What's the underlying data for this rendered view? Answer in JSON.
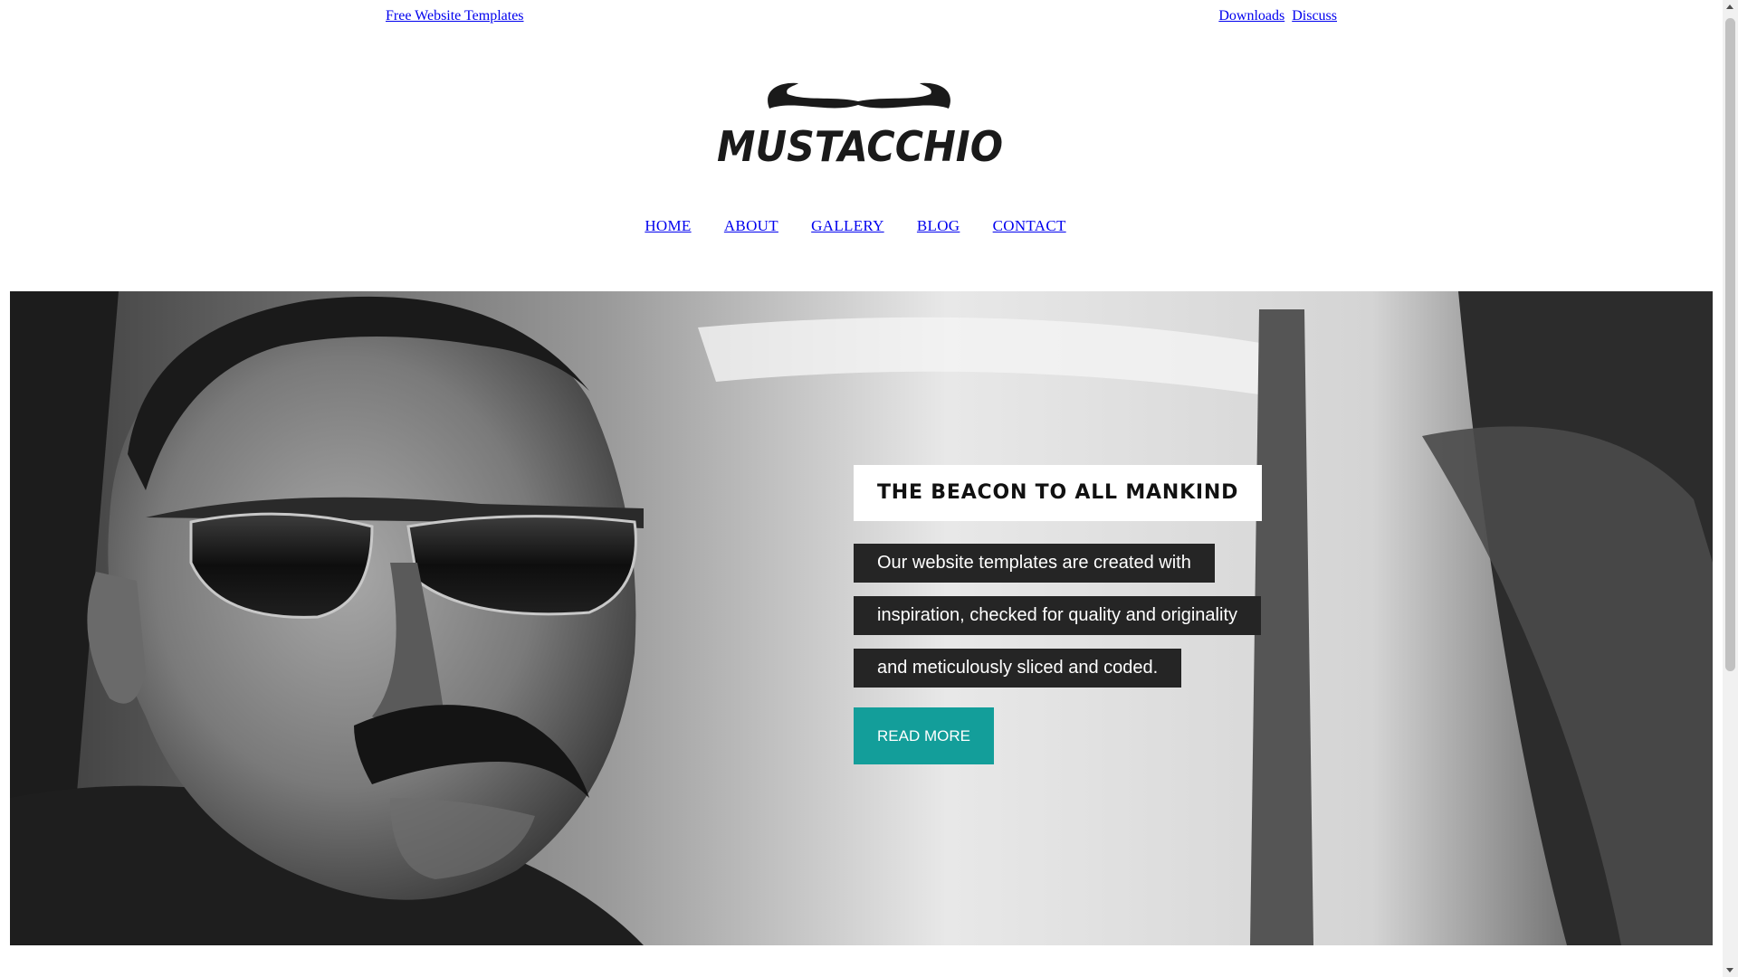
{
  "topbar": {
    "left_link": "Free Website Templates",
    "right_links": [
      "Downloads",
      "Discuss"
    ]
  },
  "logo": {
    "text": "MUSTACCHIO"
  },
  "nav": {
    "items": [
      "HOME",
      "ABOUT",
      "GALLERY",
      "BLOG",
      "CONTACT"
    ]
  },
  "hero": {
    "image": "black-and-white photo of a mustached man in sunglasses in a car",
    "headline": "THE BEACON TO ALL MANKIND",
    "lines": [
      "Our website templates are created with",
      "inspiration, checked for quality and originality",
      "and meticulously sliced and coded."
    ],
    "button_label": "READ MORE"
  },
  "colors": {
    "link": "#0000ee",
    "accent": "#139e9a",
    "caption_bg": "#252525"
  }
}
